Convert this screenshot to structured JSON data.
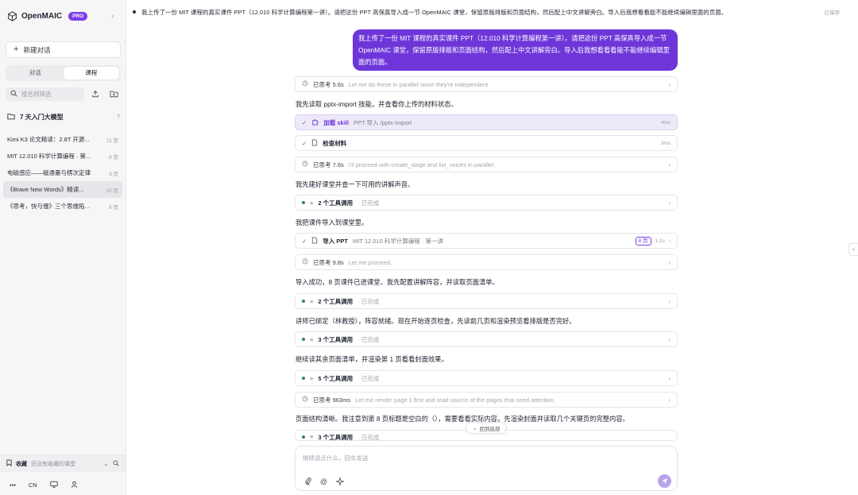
{
  "brand": {
    "name": "OpenMAIC",
    "badge": "PRO"
  },
  "sidebar": {
    "new_chat": "新建对话",
    "tabs": [
      {
        "label": "对话"
      },
      {
        "label": "课程"
      }
    ],
    "search": {
      "placeholder": "按名称筛选"
    },
    "folder": {
      "label": "7 天入门大模型",
      "count": "7"
    },
    "conversations": [
      {
        "title": "Kimi K3 论文精读：2.8T 开源...",
        "count": "11 页"
      },
      {
        "title": "MIT 12.010 科学计算编程 · 第...",
        "count": "8 页"
      },
      {
        "title": "电磁感应——磁通量与楞次定律",
        "count": "3 页"
      },
      {
        "title": "《Brave New Words》精读...",
        "count": "10 页"
      },
      {
        "title": "《思考，快与慢》三个思维陷...",
        "count": "8 页"
      }
    ],
    "favorites": {
      "label": "收藏",
      "hint": "还没有收藏的课堂"
    },
    "bottom": {
      "lang": "CN"
    }
  },
  "topbar": {
    "title": "我上传了一份 MIT 课程的真实课件 PPT（12.010 科学计算编程第一讲）。请把这份 PPT 高保真导入成一节 OpenMAIC 课堂，保留原版排版和页面结构，然后配上中文讲解旁白。导入后我想看看能不能继续编辑里面的页面。",
    "status": "已保存"
  },
  "chat": {
    "user_message": "我上传了一份 MIT 课程的真实课件 PPT（12.010 科学计算编程第一讲）。请把这份 PPT 高保真导入成一节 OpenMAIC 课堂，保留原版排版和页面结构，然后配上中文讲解旁白。导入后我想看看看能不能继续编辑里面的页面。",
    "think1": {
      "label": "已思考 5.6s",
      "text": "Let me do these in parallel since they're independent."
    },
    "msg1": "我先读取 pptx-import 技能，并查看你上传的材料状态。",
    "skill": {
      "label": "加载 skill",
      "detail": "PPT 导入 /pptx-import",
      "time": "4ms"
    },
    "check": {
      "label": "检查材料",
      "time": "3ms"
    },
    "think2": {
      "label": "已思考 7.6s",
      "text": "I'll proceed with create_stage and list_voices in parallel."
    },
    "msg2": "我先建好课堂并查一下可用的讲解声音。",
    "tools1": {
      "label": "2 个工具调用",
      "status": "· 已完成"
    },
    "msg3": "我把课件导入到课堂里。",
    "import": {
      "label": "导入 PPT",
      "detail": "MIT 12.010 科学计算编程 · 第一讲",
      "badge": "8 页",
      "time": "1.2s"
    },
    "think3": {
      "label": "已思考 9.8s",
      "text": "Let me proceed."
    },
    "msg4": "导入成功，8 页课件已进课堂。我先配置讲解阵容，并读取页面清单。",
    "tools2": {
      "label": "2 个工具调用",
      "status": "· 已完成"
    },
    "msg5": "讲师已绑定（林教授），阵容就绪。现在开始逐页检查，先读前几页和渲染预览看排版是否完好。",
    "tools3": {
      "label": "3 个工具调用",
      "status": "· 已完成"
    },
    "msg6": "继续读其余页面清单，并渲染第 1 页看看封面效果。",
    "tools4": {
      "label": "5 个工具调用",
      "status": "· 已完成"
    },
    "think4": {
      "label": "已思考 963ms",
      "text": "Let me render page 1 first and read source of the pages that need attention."
    },
    "msg7": "页面结构清晰。我注意到第 8 页标题是空白的（），需要看看实际内容。先渲染封面并读取几个关键页的完整内容。",
    "tools5": {
      "label": "3 个工具调用",
      "status": "· 已完成"
    },
    "back_to_bottom": "回到底部"
  },
  "composer": {
    "placeholder": "继续说点什么，回车发送"
  },
  "colors": {
    "accent": "#6e36d9",
    "send_disabled": "#b9a4ec",
    "done_dot": "#2e8b57"
  }
}
